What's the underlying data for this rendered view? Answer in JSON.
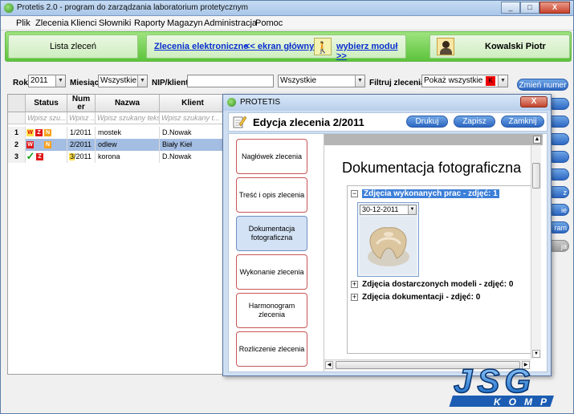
{
  "app": {
    "title": "Protetis 2.0 - program do zarządzania laboratorium protetycznym"
  },
  "window_buttons": {
    "minimize": "_",
    "maximize": "□",
    "close": "X"
  },
  "menu": [
    "Plik",
    "Zlecenia",
    "Klienci",
    "Słowniki",
    "Raporty",
    "Magazyn",
    "Administracja",
    "Pomoc"
  ],
  "topbar": {
    "lista": "Lista zleceń",
    "elektroniczne": "Zlecenia elektroniczne",
    "ekran": "<< ekran główny",
    "wybierz": "wybierz moduł >>",
    "user": "Kowalski Piotr"
  },
  "filters": {
    "rok_label": "Rok",
    "rok_value": "2011",
    "miesiac_label": "Miesiąc",
    "miesiac_value": "Wszystkie",
    "nip_label": "NIP/klient",
    "nip_value": "",
    "status_value": "Wszystkie",
    "filtruj_label": "Filtruj zlecenia",
    "filtruj_value": "Pokaż wszystkie",
    "zmien_btn": "Zmień numer"
  },
  "side_buttons": [
    "",
    "",
    "",
    "",
    "",
    "z",
    "ie",
    "ram",
    "ja"
  ],
  "grid": {
    "columns": [
      "Status",
      "Numer",
      "Nazwa",
      "Klient"
    ],
    "filter_placeholders": [
      "Wpisz szu...",
      "Wpisz ...",
      "Wpisz szukany tekst",
      "Wpisz szukany t..."
    ],
    "rows": [
      {
        "n": "1",
        "numer": "1/2011",
        "nazwa": "mostek",
        "klient": "D.Nowak",
        "selected": false,
        "badges": [
          "W",
          "Z",
          "N"
        ]
      },
      {
        "n": "2",
        "numer": "2/2011",
        "nazwa": "odlew",
        "klient": "Biały Kieł",
        "selected": true,
        "badges": [
          "W",
          "",
          "N"
        ]
      },
      {
        "n": "3",
        "numer": "3/2011",
        "nazwa": "korona",
        "klient": "D.Nowak",
        "selected": false,
        "badges": [
          "✓",
          "Z",
          ""
        ]
      }
    ]
  },
  "dialog": {
    "title": "PROTETIS",
    "close": "X",
    "header": "Edycja zlecenia 2/2011",
    "btn_druk": "Drukuj",
    "btn_zapisz": "Zapisz",
    "btn_zamknij": "Zamknij",
    "tabs": [
      "Nagłówek zlecenia",
      "Treść i opis zlecenia",
      "Dokumentacja fotograficzna",
      "Wykonanie zlecenia",
      "Harmonogram zlecenia",
      "Rozliczenie zlecenia"
    ],
    "active_tab": 2,
    "content_title": "Dokumentacja fotograficzna",
    "tree": {
      "node1": "Zdjęcia wykonanych prac - zdjęć: 1",
      "photo_date": "30-12-2011",
      "node2": "Zdjęcia dostarczonych modeli - zdjęć: 0",
      "node3": "Zdjęcia dokumentacji - zdjęć: 0"
    }
  },
  "logo": {
    "line1": "JSG",
    "line2": "KOMP"
  },
  "colors": {
    "green": "#5cc33b",
    "accent_blue": "#2d67c2",
    "selection": "#a4bde2"
  }
}
